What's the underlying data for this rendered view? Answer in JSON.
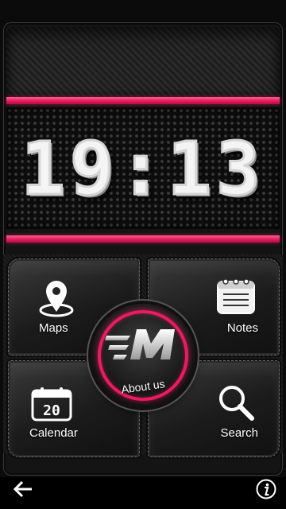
{
  "clock": {
    "time": "19:13"
  },
  "menu": {
    "maps_label": "Maps",
    "notes_label": "Notes",
    "calendar_label": "Calendar",
    "calendar_day": "20",
    "search_label": "Search",
    "about_label": "About us"
  },
  "icons": {
    "maps": "map-pin-icon",
    "notes": "notepad-icon",
    "calendar": "calendar-icon",
    "search": "magnifier-icon",
    "logo": "brand-m-logo",
    "back": "back-arrow-icon",
    "info": "info-icon"
  },
  "colors": {
    "accent": "#e91c63",
    "background": "#0b0b0b",
    "text": "#ffffff"
  }
}
